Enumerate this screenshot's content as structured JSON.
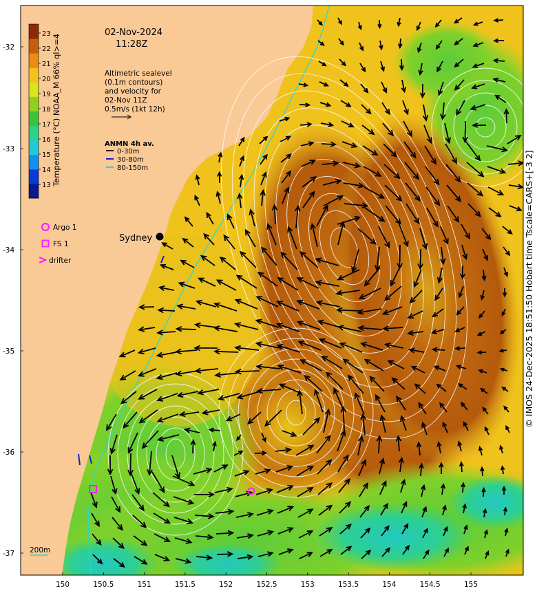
{
  "header": {
    "date": "02-Nov-2024",
    "time": "11:28Z"
  },
  "colorbar": {
    "label": "Temperature (°C) NOAA_M 66% ql>=4",
    "ticks": [
      "13",
      "14",
      "15",
      "16",
      "17",
      "18",
      "19",
      "20",
      "21",
      "22",
      "23"
    ],
    "stops": [
      "#081a8c",
      "#0a3bd6",
      "#1690ee",
      "#22c8d8",
      "#2bd28a",
      "#3fc23a",
      "#8ed21e",
      "#d8e41c",
      "#f5c21a",
      "#ea8c12",
      "#c4600c",
      "#8c2a08"
    ]
  },
  "annotation": {
    "lines": [
      "Altimetric sealevel",
      "(0.1m contours)",
      "and velocity for",
      "02-Nov 11Z",
      "0.5m/s (1kt 12h)"
    ]
  },
  "mooring_legend": {
    "title": "ANMN 4h av.",
    "items": [
      {
        "label": "0-30m",
        "color": "#000000"
      },
      {
        "label": "30-80m",
        "color": "#1a1acc"
      },
      {
        "label": "80-150m",
        "color": "#22d8d8"
      }
    ]
  },
  "platform_legend": [
    {
      "label": "Argo 1",
      "symbol": "circle",
      "color": "#ff22ff"
    },
    {
      "label": "FS 1",
      "symbol": "square",
      "color": "#ff22ff"
    },
    {
      "label": "drifter",
      "symbol": "chevron",
      "color": "#ff22ff"
    }
  ],
  "city": "Sydney",
  "isobath_label": "200m",
  "axes": {
    "x_ticks": [
      "150",
      "150.5",
      "151",
      "151.5",
      "152",
      "152.5",
      "153",
      "153.5",
      "154",
      "154.5",
      "155"
    ],
    "y_ticks": [
      "-32",
      "-33",
      "-34",
      "-35",
      "-36",
      "-37"
    ]
  },
  "credit": "© IMOS 24-Dec-2025 18:51:50 Hobart time Tscale=CARS+[-3 2]",
  "colors": {
    "land": "#f9c996",
    "warm_core": "#c0690f",
    "cool_shelf": "#66d43a",
    "arrow": "#000000",
    "contour": "#ffffff",
    "isobath": "#22d8d8",
    "marker": "#ff22ff"
  }
}
